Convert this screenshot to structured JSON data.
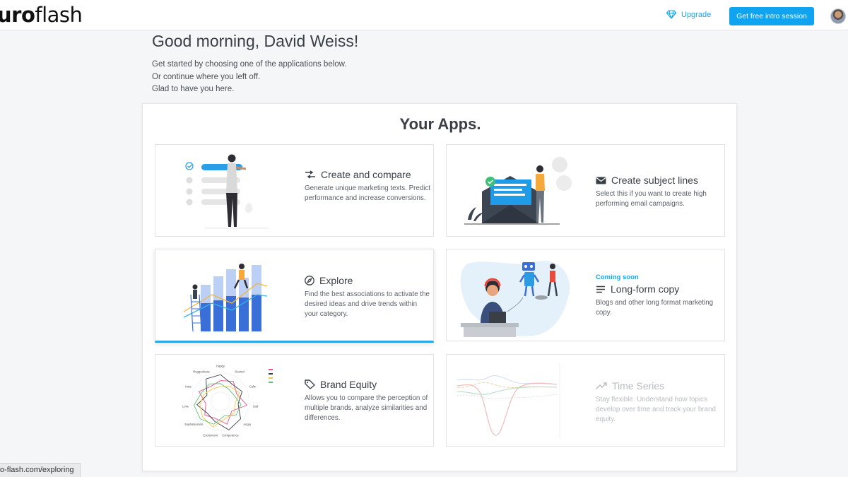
{
  "header": {
    "logo_bold": "uro",
    "logo_light": "flash",
    "upgrade_label": "Upgrade",
    "cta_label": "Get free intro session"
  },
  "greeting": "Good morning, David Weiss!",
  "intro": [
    "Get started by choosing one of the applications below.",
    "Or continue where you left off.",
    "Glad to have you here."
  ],
  "panel_title": "Your Apps.",
  "apps": [
    {
      "title": "Create and compare",
      "icon": "compare-arrows-icon",
      "desc": "Generate unique marketing texts. Predict performance and increase conversions.",
      "badge": ""
    },
    {
      "title": "Create subject lines",
      "icon": "envelope-icon",
      "desc": "Select this if you want to create high performing email campaigns.",
      "badge": ""
    },
    {
      "title": "Explore",
      "icon": "compass-icon",
      "desc": "Find the best associations to activate the desired ideas and drive trends within your category.",
      "badge": ""
    },
    {
      "title": "Long-form copy",
      "icon": "text-lines-icon",
      "desc": "Blogs and other long format marketing copy.",
      "badge": "Coming soon"
    },
    {
      "title": "Brand Equity",
      "icon": "tag-icon",
      "desc": "Allows you to compare the perception of multiple brands, analyze similarities and differences.",
      "badge": ""
    },
    {
      "title": "Time Series",
      "icon": "trend-up-icon",
      "desc": "Stay flexible. Understand how topics develop over time and track your brand equity.",
      "badge": ""
    }
  ],
  "radar_labels": [
    "Happy",
    "Scared",
    "Calm",
    "Sad",
    "Angry",
    "Competence",
    "Excitement",
    "Sophistication",
    "Love",
    "Hate",
    "Ruggedness"
  ],
  "status_url": "o-flash.com/exploring",
  "colors": {
    "accent": "#0fa3f0",
    "illustration_blue": "#3b6fd8",
    "illustration_light": "#a9c4f5"
  }
}
